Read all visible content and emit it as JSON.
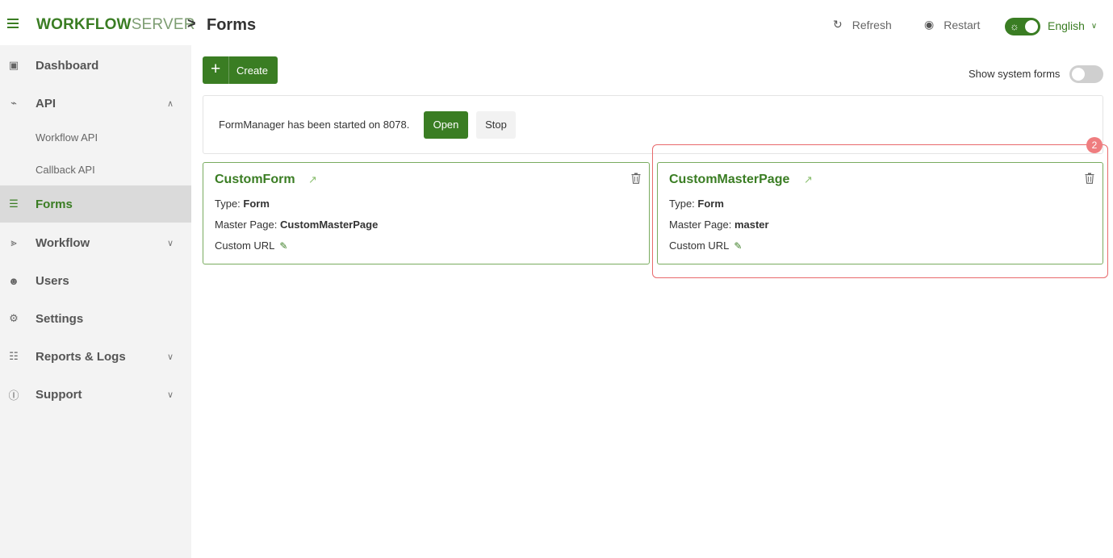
{
  "header": {
    "logo_bold": "WORKFLOW",
    "logo_light": "SERVER",
    "breadcrumb_sep": ">",
    "page_title": "Forms",
    "refresh_label": "Refresh",
    "restart_label": "Restart",
    "language": "English"
  },
  "sidebar": {
    "items": [
      {
        "label": "Dashboard",
        "icon": "dashboard-icon"
      },
      {
        "label": "API",
        "icon": "plug-icon"
      },
      {
        "label": "Forms",
        "icon": "form-icon"
      },
      {
        "label": "Workflow",
        "icon": "workflow-icon"
      },
      {
        "label": "Users",
        "icon": "users-icon"
      },
      {
        "label": "Settings",
        "icon": "gears-icon"
      },
      {
        "label": "Reports & Logs",
        "icon": "reports-icon"
      },
      {
        "label": "Support",
        "icon": "help-icon"
      }
    ],
    "api_sub": [
      "Workflow API",
      "Callback API"
    ]
  },
  "toolbar": {
    "create_label": "Create",
    "show_system_label": "Show system forms"
  },
  "form_manager": {
    "status_text": "FormManager has been started on 8078.",
    "open_label": "Open",
    "stop_label": "Stop"
  },
  "cards": [
    {
      "title": "CustomForm",
      "type_label": "Type: ",
      "type_value": "Form",
      "master_label": "Master Page: ",
      "master_value": "CustomMasterPage",
      "custom_url_label": "Custom URL"
    },
    {
      "title": "CustomMasterPage",
      "type_label": "Type: ",
      "type_value": "Form",
      "master_label": "Master Page: ",
      "master_value": "master",
      "custom_url_label": "Custom URL"
    }
  ],
  "annotation_badge": "2",
  "colors": {
    "accent": "#3a7d23",
    "highlight": "#e8696b"
  }
}
